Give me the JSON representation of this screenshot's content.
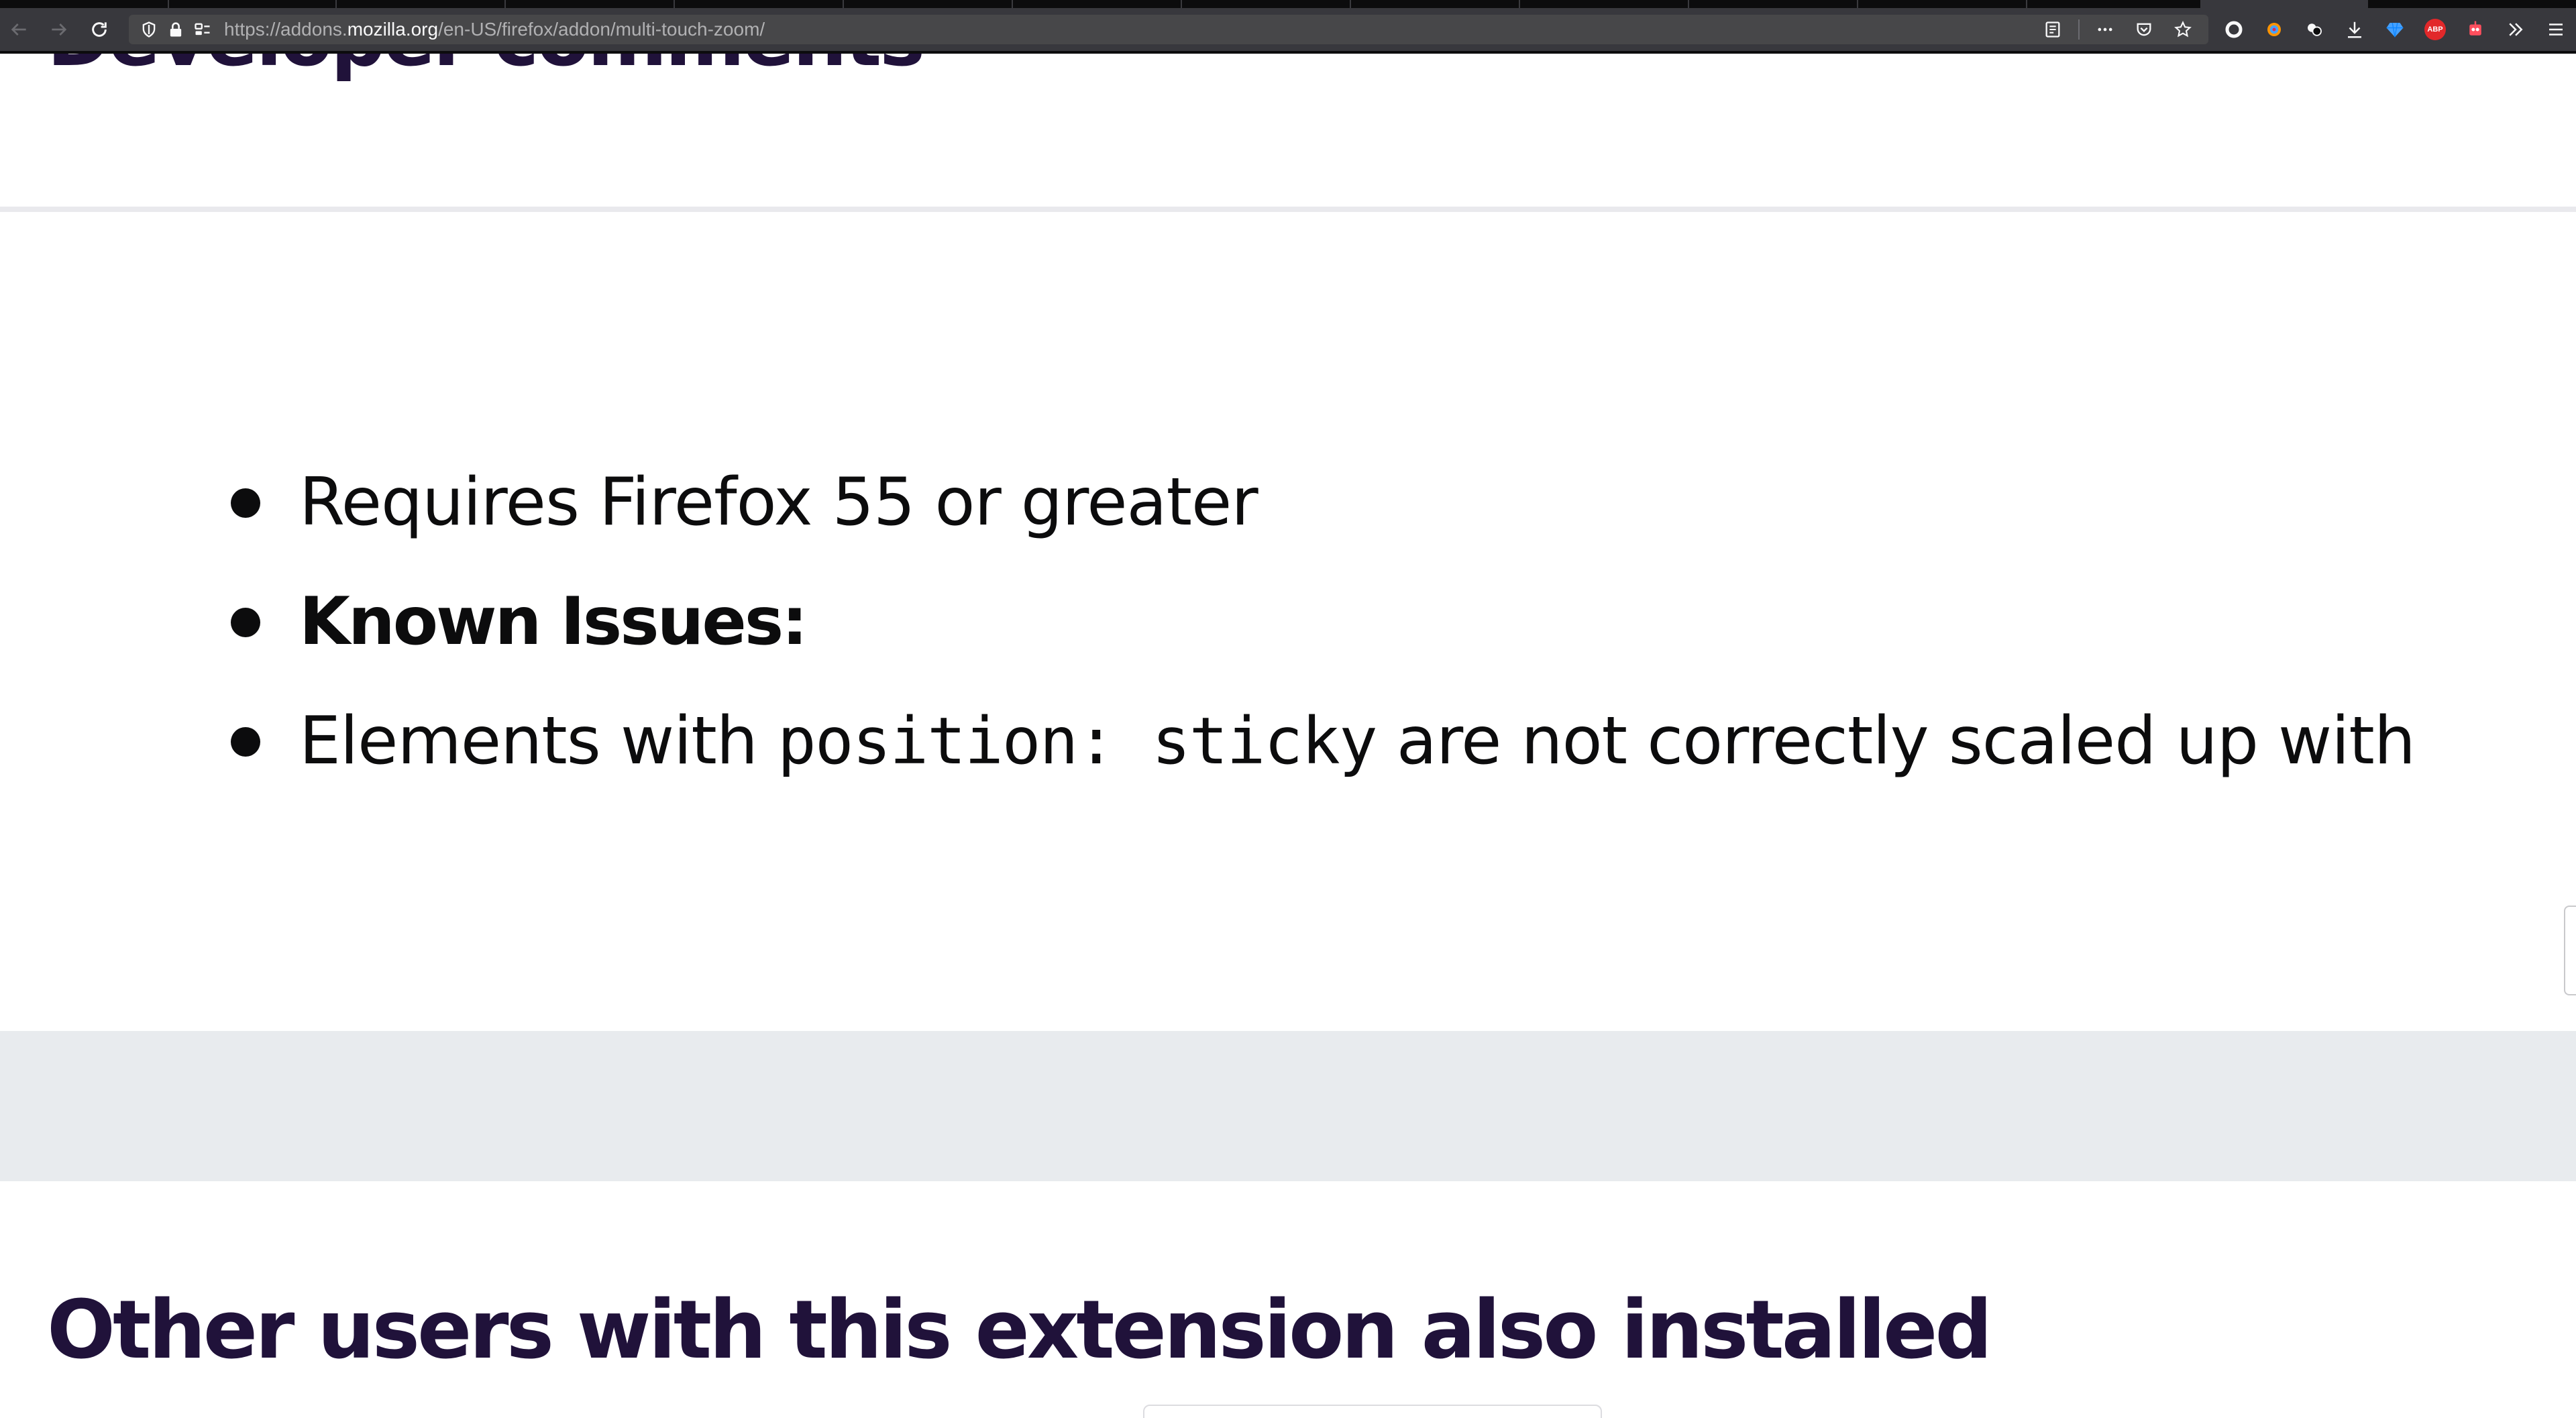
{
  "browser": {
    "url_prefix": "https://addons.",
    "url_domain": "mozilla.org",
    "url_path": "/en-US/firefox/addon/multi-touch-zoom/",
    "extension_badge_abp": "ABP",
    "icons": {
      "back": "back-arrow-icon",
      "forward": "forward-arrow-icon",
      "reload": "reload-icon",
      "tracking": "shield-icon",
      "lock": "lock-icon",
      "permissions": "permissions-icon",
      "reader": "reader-view-icon",
      "page_actions": "ellipsis-icon",
      "pocket": "pocket-icon",
      "bookmark": "star-icon",
      "downloads": "download-icon",
      "overflow": "chevron-double-right-icon",
      "menu": "hamburger-menu-icon"
    }
  },
  "page": {
    "top_heading": "Developer comments",
    "developer_comments": {
      "item1": "Requires Firefox 55 or greater",
      "item2": "Known Issues:",
      "item3_before": "Elements with ",
      "item3_code": "position: sticky",
      "item3_after": " are not correctly scaled up with"
    },
    "bottom_heading": "Other users with this extension also installed"
  }
}
